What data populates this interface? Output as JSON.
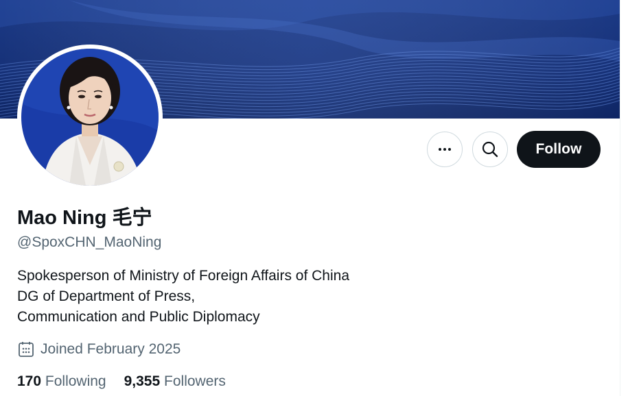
{
  "banner": {
    "colors": {
      "top": "#1f3f8c",
      "bottom": "#0d2466"
    }
  },
  "avatar": {
    "alt_desc": "profile photo"
  },
  "actions": {
    "more_icon": "ellipsis-icon",
    "search_icon": "search-icon",
    "follow_label": "Follow"
  },
  "profile": {
    "name": "Mao Ning 毛宁",
    "handle": "@SpoxCHN_MaoNing",
    "bio_lines": [
      "Spokesperson of Ministry of Foreign Affairs of China",
      "DG of Department of Press,",
      "Communication and Public Diplomacy"
    ],
    "joined": "Joined February 2025"
  },
  "stats": {
    "following_count": "170",
    "following_label": "Following",
    "followers_count": "9,355",
    "followers_label": "Followers"
  },
  "colors": {
    "accent": "#0f1419",
    "muted": "#536471",
    "border": "#cfd9de"
  }
}
